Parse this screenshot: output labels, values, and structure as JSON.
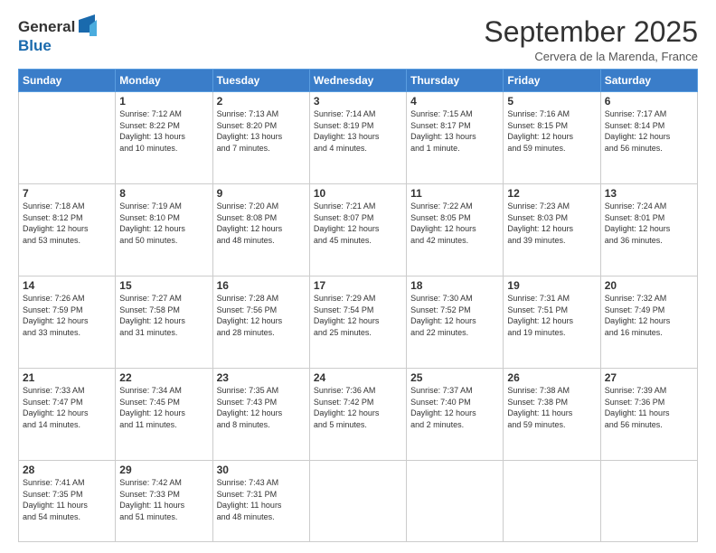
{
  "logo": {
    "general": "General",
    "blue": "Blue"
  },
  "title": "September 2025",
  "location": "Cervera de la Marenda, France",
  "header_days": [
    "Sunday",
    "Monday",
    "Tuesday",
    "Wednesday",
    "Thursday",
    "Friday",
    "Saturday"
  ],
  "weeks": [
    [
      {
        "day": "",
        "info": ""
      },
      {
        "day": "1",
        "info": "Sunrise: 7:12 AM\nSunset: 8:22 PM\nDaylight: 13 hours\nand 10 minutes."
      },
      {
        "day": "2",
        "info": "Sunrise: 7:13 AM\nSunset: 8:20 PM\nDaylight: 13 hours\nand 7 minutes."
      },
      {
        "day": "3",
        "info": "Sunrise: 7:14 AM\nSunset: 8:19 PM\nDaylight: 13 hours\nand 4 minutes."
      },
      {
        "day": "4",
        "info": "Sunrise: 7:15 AM\nSunset: 8:17 PM\nDaylight: 13 hours\nand 1 minute."
      },
      {
        "day": "5",
        "info": "Sunrise: 7:16 AM\nSunset: 8:15 PM\nDaylight: 12 hours\nand 59 minutes."
      },
      {
        "day": "6",
        "info": "Sunrise: 7:17 AM\nSunset: 8:14 PM\nDaylight: 12 hours\nand 56 minutes."
      }
    ],
    [
      {
        "day": "7",
        "info": "Sunrise: 7:18 AM\nSunset: 8:12 PM\nDaylight: 12 hours\nand 53 minutes."
      },
      {
        "day": "8",
        "info": "Sunrise: 7:19 AM\nSunset: 8:10 PM\nDaylight: 12 hours\nand 50 minutes."
      },
      {
        "day": "9",
        "info": "Sunrise: 7:20 AM\nSunset: 8:08 PM\nDaylight: 12 hours\nand 48 minutes."
      },
      {
        "day": "10",
        "info": "Sunrise: 7:21 AM\nSunset: 8:07 PM\nDaylight: 12 hours\nand 45 minutes."
      },
      {
        "day": "11",
        "info": "Sunrise: 7:22 AM\nSunset: 8:05 PM\nDaylight: 12 hours\nand 42 minutes."
      },
      {
        "day": "12",
        "info": "Sunrise: 7:23 AM\nSunset: 8:03 PM\nDaylight: 12 hours\nand 39 minutes."
      },
      {
        "day": "13",
        "info": "Sunrise: 7:24 AM\nSunset: 8:01 PM\nDaylight: 12 hours\nand 36 minutes."
      }
    ],
    [
      {
        "day": "14",
        "info": "Sunrise: 7:26 AM\nSunset: 7:59 PM\nDaylight: 12 hours\nand 33 minutes."
      },
      {
        "day": "15",
        "info": "Sunrise: 7:27 AM\nSunset: 7:58 PM\nDaylight: 12 hours\nand 31 minutes."
      },
      {
        "day": "16",
        "info": "Sunrise: 7:28 AM\nSunset: 7:56 PM\nDaylight: 12 hours\nand 28 minutes."
      },
      {
        "day": "17",
        "info": "Sunrise: 7:29 AM\nSunset: 7:54 PM\nDaylight: 12 hours\nand 25 minutes."
      },
      {
        "day": "18",
        "info": "Sunrise: 7:30 AM\nSunset: 7:52 PM\nDaylight: 12 hours\nand 22 minutes."
      },
      {
        "day": "19",
        "info": "Sunrise: 7:31 AM\nSunset: 7:51 PM\nDaylight: 12 hours\nand 19 minutes."
      },
      {
        "day": "20",
        "info": "Sunrise: 7:32 AM\nSunset: 7:49 PM\nDaylight: 12 hours\nand 16 minutes."
      }
    ],
    [
      {
        "day": "21",
        "info": "Sunrise: 7:33 AM\nSunset: 7:47 PM\nDaylight: 12 hours\nand 14 minutes."
      },
      {
        "day": "22",
        "info": "Sunrise: 7:34 AM\nSunset: 7:45 PM\nDaylight: 12 hours\nand 11 minutes."
      },
      {
        "day": "23",
        "info": "Sunrise: 7:35 AM\nSunset: 7:43 PM\nDaylight: 12 hours\nand 8 minutes."
      },
      {
        "day": "24",
        "info": "Sunrise: 7:36 AM\nSunset: 7:42 PM\nDaylight: 12 hours\nand 5 minutes."
      },
      {
        "day": "25",
        "info": "Sunrise: 7:37 AM\nSunset: 7:40 PM\nDaylight: 12 hours\nand 2 minutes."
      },
      {
        "day": "26",
        "info": "Sunrise: 7:38 AM\nSunset: 7:38 PM\nDaylight: 11 hours\nand 59 minutes."
      },
      {
        "day": "27",
        "info": "Sunrise: 7:39 AM\nSunset: 7:36 PM\nDaylight: 11 hours\nand 56 minutes."
      }
    ],
    [
      {
        "day": "28",
        "info": "Sunrise: 7:41 AM\nSunset: 7:35 PM\nDaylight: 11 hours\nand 54 minutes."
      },
      {
        "day": "29",
        "info": "Sunrise: 7:42 AM\nSunset: 7:33 PM\nDaylight: 11 hours\nand 51 minutes."
      },
      {
        "day": "30",
        "info": "Sunrise: 7:43 AM\nSunset: 7:31 PM\nDaylight: 11 hours\nand 48 minutes."
      },
      {
        "day": "",
        "info": ""
      },
      {
        "day": "",
        "info": ""
      },
      {
        "day": "",
        "info": ""
      },
      {
        "day": "",
        "info": ""
      }
    ]
  ]
}
